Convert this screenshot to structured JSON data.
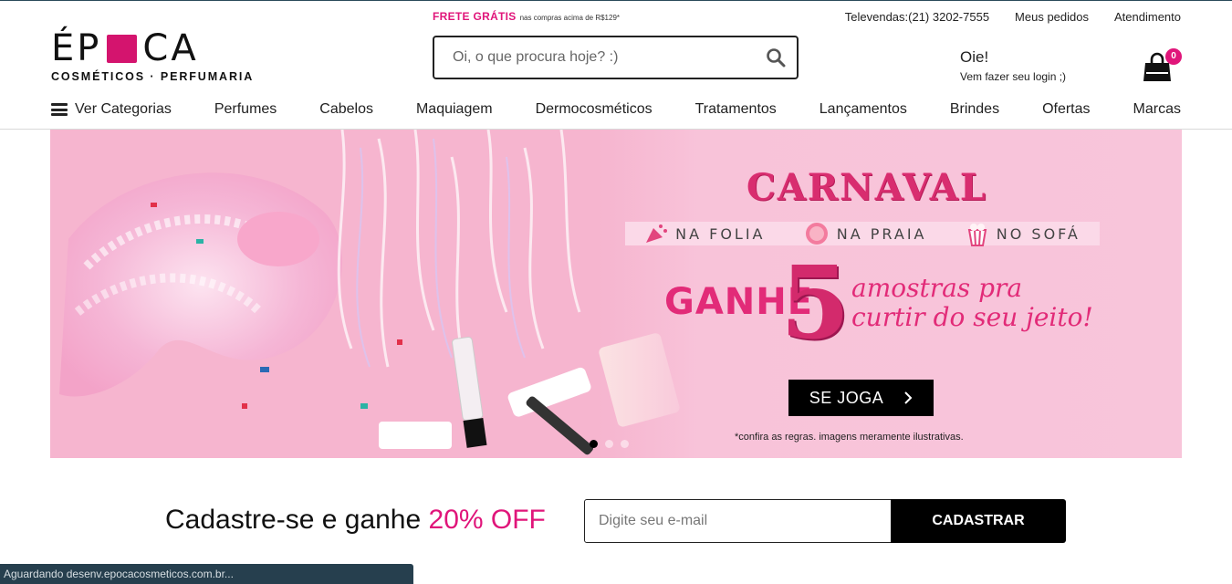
{
  "header": {
    "logo": {
      "word_left": "ÉP",
      "word_right": "CA",
      "tagline": "COSMÉTICOS · PERFUMARIA"
    },
    "promo": {
      "highlight": "FRETE GRÁTIS",
      "detail": "nas compras acima de R$129*"
    },
    "top_links": [
      "Televendas:(21) 3202-7555",
      "Meus pedidos",
      "Atendimento"
    ],
    "search": {
      "placeholder": "Oi, o que procura hoje? :)",
      "icon": "search-icon"
    },
    "login": {
      "greeting": "Oie!",
      "prompt": "Vem fazer seu login ;)"
    },
    "cart": {
      "count": "0",
      "icon": "shopping-bag-icon"
    }
  },
  "nav": {
    "categories_label": "Ver Categorias",
    "items": [
      "Perfumes",
      "Cabelos",
      "Maquiagem",
      "Dermocosméticos",
      "Tratamentos",
      "Lançamentos",
      "Brindes",
      "Ofertas",
      "Marcas"
    ]
  },
  "banner": {
    "title": "CARNAVAL",
    "strip": [
      "NA FOLIA",
      "NA PRAIA",
      "NO SOFÁ"
    ],
    "ganhe": "GANHE",
    "number": "5",
    "amostras_line1": "amostras pra",
    "amostras_line2": "curtir do seu jeito!",
    "cta": "SE JOGA",
    "rules": "*confira as regras. imagens meramente ilustrativas.",
    "slides": 3,
    "active_slide": 0,
    "colors": {
      "background": "#f8c3d9",
      "accent": "#e22b78"
    }
  },
  "newsletter": {
    "text": "Cadastre-se e ganhe ",
    "highlight": "20% OFF",
    "placeholder": "Digite seu e-mail",
    "button": "CADASTRAR"
  },
  "status_bar": "Aguardando desenv.epocacosmeticos.com.br..."
}
